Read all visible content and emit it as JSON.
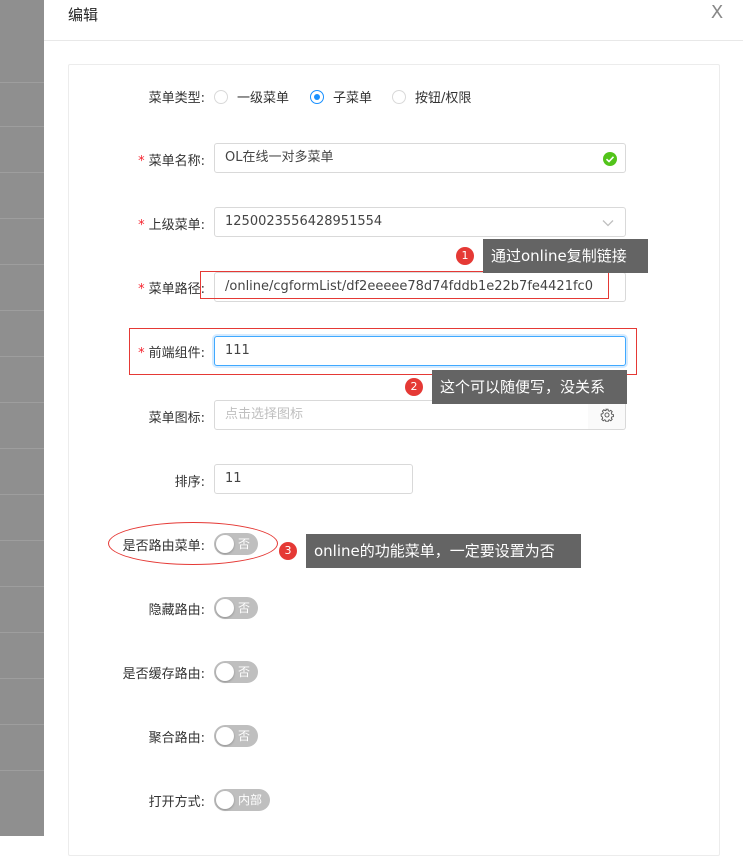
{
  "drawer": {
    "title": "编辑",
    "close_label": "X"
  },
  "form": {
    "menu_type": {
      "label": "菜单类型:",
      "options": [
        "一级菜单",
        "子菜单",
        "按钮/权限"
      ],
      "selected_index": 1
    },
    "menu_name": {
      "label": "菜单名称:",
      "value": "OL在线一对多菜单",
      "required": true
    },
    "parent_menu": {
      "label": "上级菜单:",
      "value": "1250023556428951554",
      "required": true
    },
    "menu_path": {
      "label": "菜单路径:",
      "value": "/online/cgformList/df2eeeee78d74fddb1e22b7fe4421fc0",
      "required": true
    },
    "frontend_component": {
      "label": "前端组件:",
      "value": "111",
      "required": true
    },
    "menu_icon": {
      "label": "菜单图标:",
      "placeholder": "点击选择图标"
    },
    "sort": {
      "label": "排序:",
      "value": "11"
    },
    "is_route_menu": {
      "label": "是否路由菜单:",
      "switch_text": "否",
      "on": false
    },
    "hide_route": {
      "label": "隐藏路由:",
      "switch_text": "否",
      "on": false
    },
    "cache_route": {
      "label": "是否缓存路由:",
      "switch_text": "否",
      "on": false
    },
    "aggregate_route": {
      "label": "聚合路由:",
      "switch_text": "否",
      "on": false
    },
    "open_mode": {
      "label": "打开方式:",
      "switch_text": "内部",
      "on": false
    }
  },
  "annotations": [
    {
      "number": "1",
      "text": "通过online复制链接"
    },
    {
      "number": "2",
      "text": "这个可以随便写，没关系"
    },
    {
      "number": "3",
      "text": "online的功能菜单，一定要设置为否"
    }
  ],
  "colors": {
    "primary": "#1890ff",
    "required": "#f5222d",
    "success": "#52c41a",
    "annotation_red": "#e53935",
    "tooltip_bg": "#646464",
    "switch_off": "#bfbfbf"
  }
}
